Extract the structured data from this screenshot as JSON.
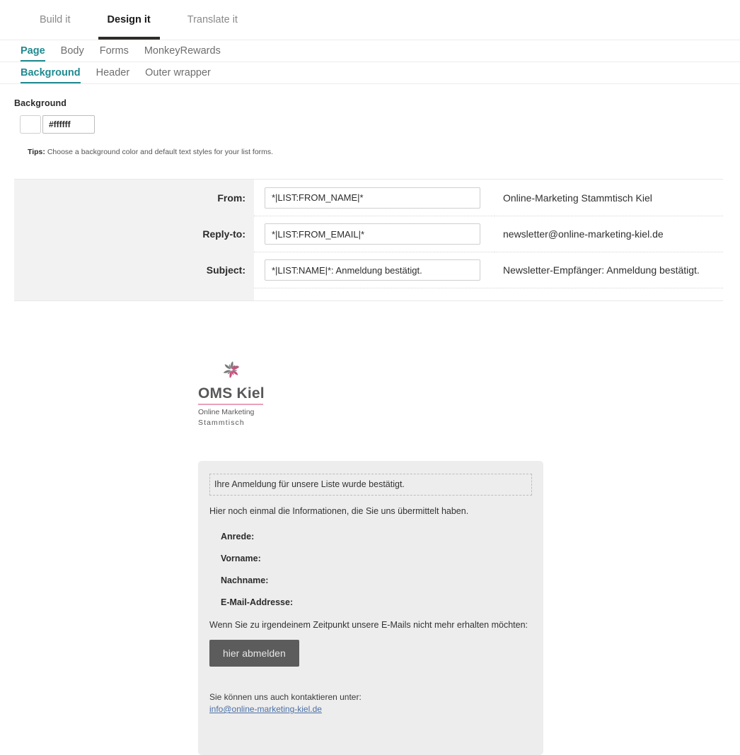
{
  "tabs_level1": [
    {
      "label": "Build it",
      "active": false
    },
    {
      "label": "Design it",
      "active": true
    },
    {
      "label": "Translate it",
      "active": false
    }
  ],
  "tabs_level2": [
    {
      "label": "Page",
      "active": true
    },
    {
      "label": "Body",
      "active": false
    },
    {
      "label": "Forms",
      "active": false
    },
    {
      "label": "MonkeyRewards",
      "active": false
    }
  ],
  "tabs_level3": [
    {
      "label": "Background",
      "active": true
    },
    {
      "label": "Header",
      "active": false
    },
    {
      "label": "Outer wrapper",
      "active": false
    }
  ],
  "background_section": {
    "label": "Background",
    "color_value": "#ffffff",
    "color_placeholder": "#ffffff",
    "swatch_color": "#ffffff",
    "tips_prefix": "Tips:",
    "tips_text": "Choose a background color and default text styles for your list forms."
  },
  "settings_table": {
    "rows": [
      {
        "label": "From:",
        "input_value": "*|LIST:FROM_NAME|*",
        "preview": "Online-Marketing Stammtisch Kiel"
      },
      {
        "label": "Reply-to:",
        "input_value": "*|LIST:FROM_EMAIL|*",
        "preview": "newsletter@online-marketing-kiel.de"
      },
      {
        "label": "Subject:",
        "input_value": "*|LIST:NAME|*: Anmeldung bestätigt.",
        "preview": "Newsletter-Empfänger: Anmeldung bestätigt."
      }
    ]
  },
  "email_preview": {
    "logo": {
      "icon": "pinwheel-icon",
      "title": "OMS Kiel",
      "subtitle_line1": "Online Marketing",
      "subtitle_line2": "Stammtisch",
      "rule_color": "#e8a0bb",
      "text_color": "#58585a"
    },
    "confirmation_message": "Ihre Anmeldung für unsere Liste wurde bestätigt.",
    "intro_text": "Hier noch einmal die Informationen, die Sie uns übermittelt haben.",
    "fields": [
      "Anrede:",
      "Vorname:",
      "Nachname:",
      "E-Mail-Addresse:"
    ],
    "unsubscribe_text": "Wenn Sie zu irgendeinem Zeitpunkt unsere E-Mails nicht mehr erhalten möchten:",
    "unsubscribe_button": "hier abmelden",
    "contact_text": "Sie können uns auch kontaktieren unter:",
    "contact_email": "info@online-marketing-kiel.de",
    "button_color": "#5c5c5c",
    "panel_color": "#ededed"
  }
}
